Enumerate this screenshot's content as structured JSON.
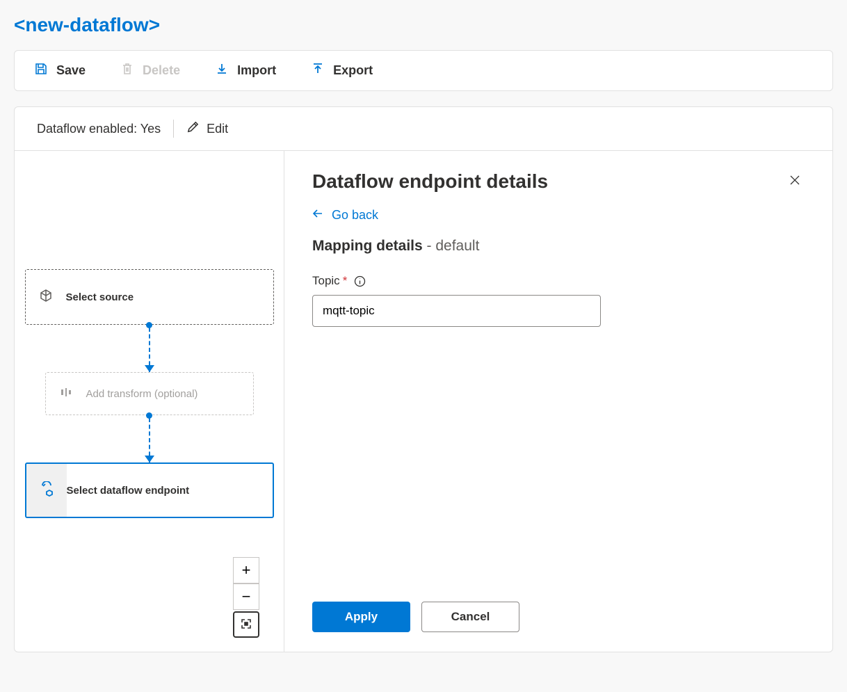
{
  "page": {
    "title": "<new-dataflow>"
  },
  "toolbar": {
    "save": "Save",
    "delete": "Delete",
    "import": "Import",
    "export": "Export"
  },
  "status": {
    "label": "Dataflow enabled: Yes",
    "edit": "Edit"
  },
  "flow": {
    "source": "Select source",
    "transform": "Add transform (optional)",
    "endpoint": "Select dataflow endpoint"
  },
  "details": {
    "title": "Dataflow endpoint details",
    "go_back": "Go back",
    "mapping_label": "Mapping details",
    "mapping_suffix": " - default",
    "topic_label": "Topic",
    "topic_value": "mqtt-topic",
    "apply": "Apply",
    "cancel": "Cancel"
  }
}
